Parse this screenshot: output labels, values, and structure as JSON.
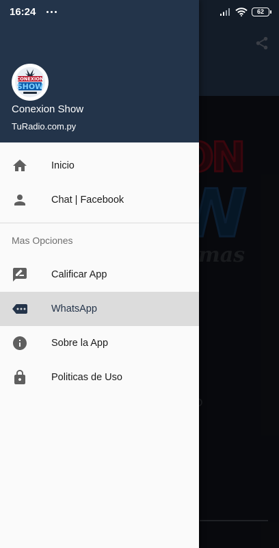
{
  "status_bar": {
    "time": "16:24",
    "battery": "62"
  },
  "drawer": {
    "title": "Conexion Show",
    "subtitle": "TuRadio.com.py",
    "logo_text_top": "CONEXION",
    "logo_text_mid": "SHOW",
    "primary_items": [
      {
        "label": "Inicio",
        "icon": "home-icon"
      },
      {
        "label": "Chat | Facebook",
        "icon": "person-icon"
      }
    ],
    "section_label": "Mas Opciones",
    "secondary_items": [
      {
        "label": "Calificar App",
        "icon": "rate-review-icon"
      },
      {
        "label": "WhatsApp",
        "icon": "message-tag-icon",
        "active": true
      },
      {
        "label": "Sobre la App",
        "icon": "info-icon"
      },
      {
        "label": "Politicas de Uso",
        "icon": "lock-icon"
      }
    ]
  },
  "background": {
    "logo_line1": "ON",
    "logo_line2": "W",
    "logo_line3": "mas"
  },
  "colors": {
    "header_bg": "#23344a",
    "active_bg": "#dcdcdc",
    "icon_gray": "#5f5f5f",
    "active_icon": "#24344a"
  }
}
